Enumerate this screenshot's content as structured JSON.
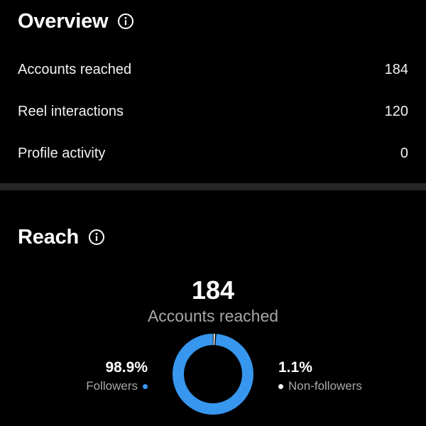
{
  "overview": {
    "title": "Overview",
    "info_icon": "info-icon",
    "metrics": [
      {
        "label": "Accounts reached",
        "value": "184"
      },
      {
        "label": "Reel interactions",
        "value": "120"
      },
      {
        "label": "Profile activity",
        "value": "0"
      }
    ]
  },
  "reach": {
    "title": "Reach",
    "info_icon": "info-icon",
    "total": "184",
    "total_label": "Accounts reached",
    "followers": {
      "percent": "98.9%",
      "label": "Followers",
      "color": "#3797ef",
      "share": 98.9
    },
    "non_followers": {
      "percent": "1.1%",
      "label": "Non-followers",
      "color": "#f5f5f5",
      "share": 1.1
    }
  },
  "colors": {
    "background": "#000000",
    "divider": "#262626",
    "muted_text": "#a8a8a8",
    "accent": "#3797ef"
  }
}
